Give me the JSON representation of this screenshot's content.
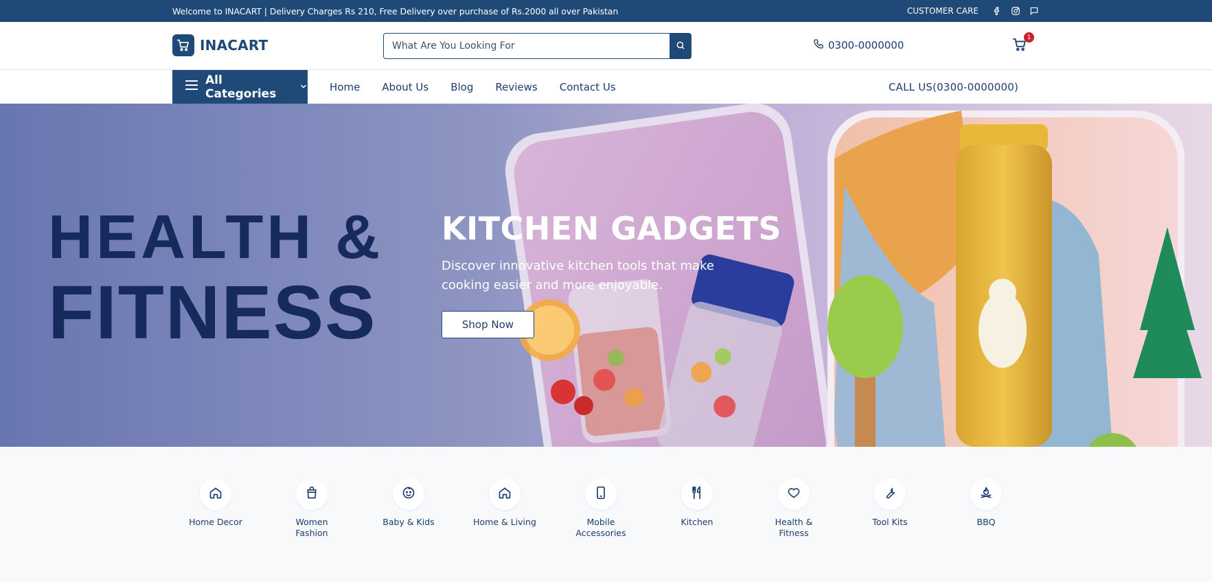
{
  "topbar": {
    "welcome": "Welcome to INACART | Delivery Charges Rs 210, Free Delivery over purchase of Rs.2000 all over Pakistan",
    "customer_care": "CUSTOMER CARE",
    "icons": [
      "facebook-icon",
      "instagram-icon",
      "chat-icon"
    ]
  },
  "header": {
    "brand": "INACART",
    "search_placeholder": "What Are You Looking For",
    "phone": "0300-0000000",
    "cart_count": "1"
  },
  "nav": {
    "all_categories": "All Categories",
    "links": [
      "Home",
      "About Us",
      "Blog",
      "Reviews",
      "Contact Us"
    ],
    "call_us": "CALL US(0300-0000000)"
  },
  "hero": {
    "left_line1": "HEALTH &",
    "left_line2": "FITNESS",
    "title": "KITCHEN GADGETS",
    "subtitle": "Discover innovative kitchen tools that make cooking easier and more enjoyable.",
    "cta": "Shop Now"
  },
  "categories": [
    {
      "label": "Home Decor",
      "icon": "home-icon"
    },
    {
      "label": "Women Fashion",
      "icon": "shopping-bag-icon"
    },
    {
      "label": "Baby & Kids",
      "icon": "baby-face-icon"
    },
    {
      "label": "Home & Living",
      "icon": "home-icon"
    },
    {
      "label": "Mobile Accessories",
      "icon": "smartphone-icon"
    },
    {
      "label": "Kitchen",
      "icon": "utensils-icon"
    },
    {
      "label": "Health & Fitness",
      "icon": "heart-icon"
    },
    {
      "label": "Tool Kits",
      "icon": "wrench-icon"
    },
    {
      "label": "BBQ",
      "icon": "flame-icon"
    }
  ],
  "colors": {
    "brand": "#1f4a78",
    "badge": "#c8202e",
    "hero_text_dark": "#162a5c"
  }
}
